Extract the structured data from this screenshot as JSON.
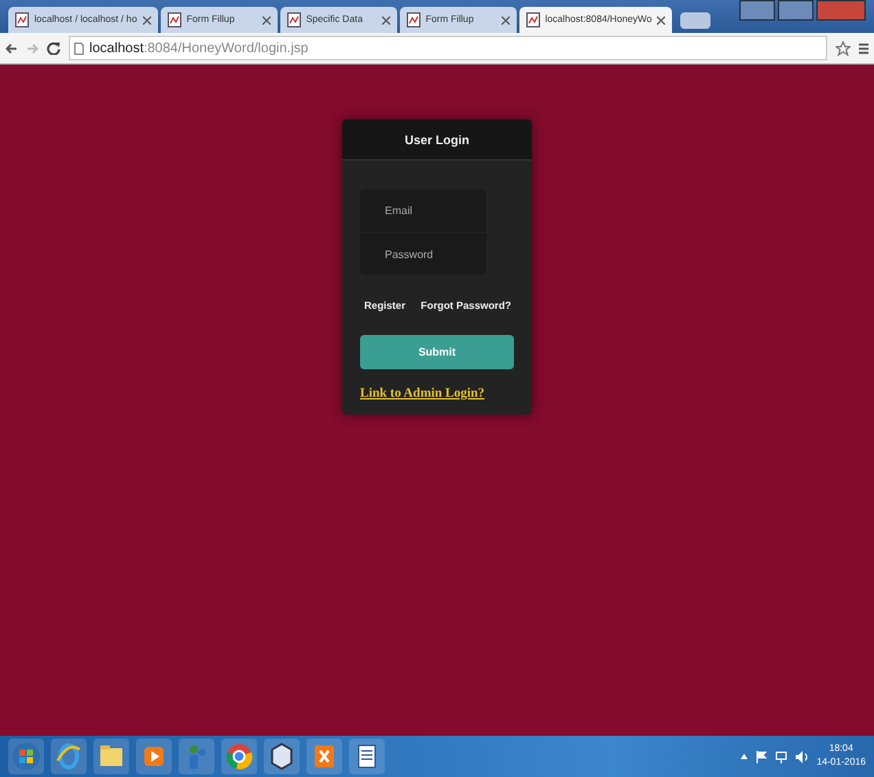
{
  "tabs": [
    {
      "label": "localhost / localhost / ho",
      "selected": false
    },
    {
      "label": "Form Fillup",
      "selected": false
    },
    {
      "label": "Specific Data",
      "selected": false
    },
    {
      "label": "Form Fillup",
      "selected": false
    },
    {
      "label": "localhost:8084/HoneyWo",
      "selected": true
    }
  ],
  "address": {
    "host": "localhost",
    "rest": ":8084/HoneyWord/login.jsp"
  },
  "login": {
    "title": "User Login",
    "email_placeholder": "Email",
    "password_placeholder": "Password",
    "register": "Register",
    "forgot": "Forgot Password?",
    "submit": "Submit",
    "admin_link": "Link to Admin Login?"
  },
  "taskbar": {
    "time": "18:04",
    "date": "14-01-2016"
  }
}
